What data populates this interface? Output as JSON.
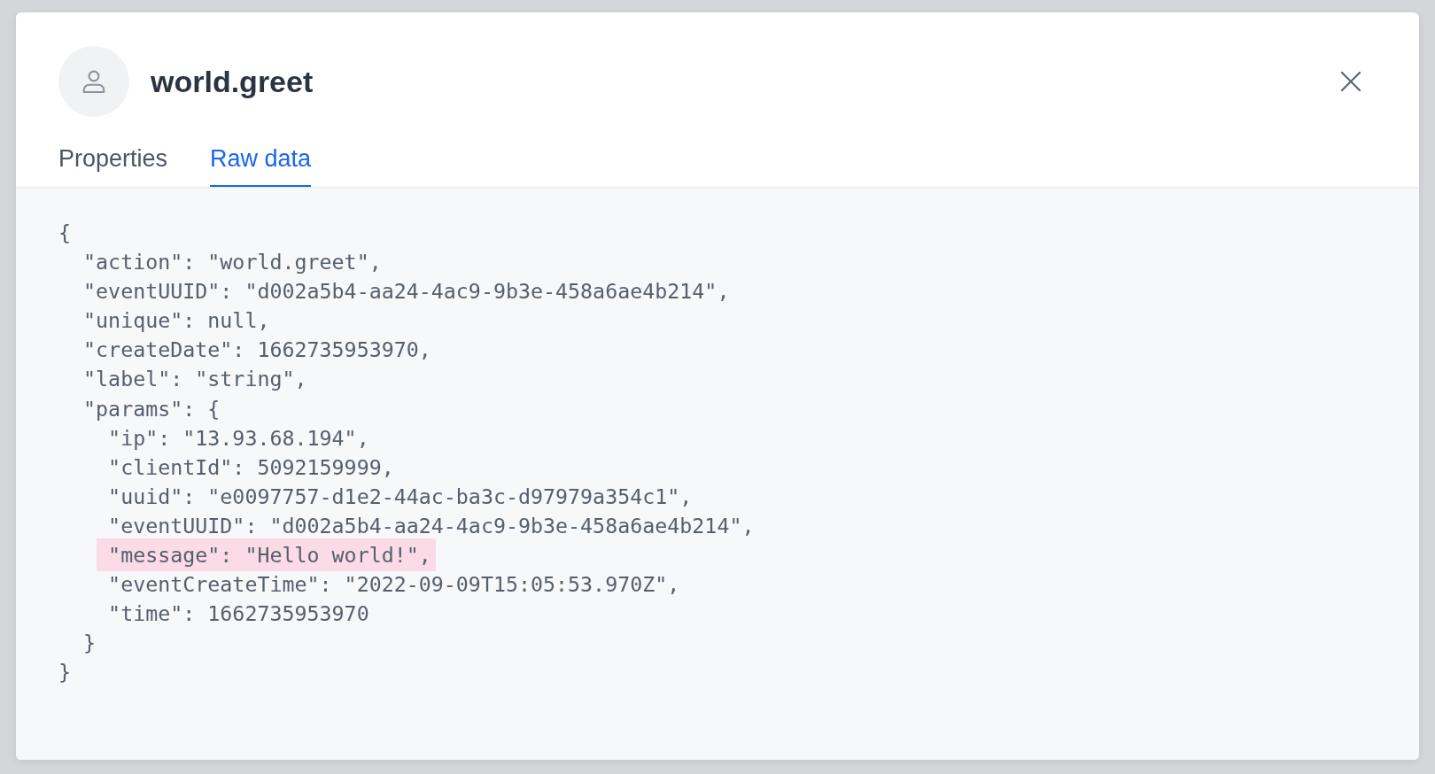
{
  "dialog": {
    "title": "world.greet",
    "tabs": [
      {
        "label": "Properties",
        "selected": false
      },
      {
        "label": "Raw data",
        "selected": true
      }
    ],
    "raw_data": {
      "lines": [
        {
          "text": "{",
          "highlighted": false
        },
        {
          "text": "  \"action\": \"world.greet\",",
          "highlighted": false
        },
        {
          "text": "  \"eventUUID\": \"d002a5b4-aa24-4ac9-9b3e-458a6ae4b214\",",
          "highlighted": false
        },
        {
          "text": "  \"unique\": null,",
          "highlighted": false
        },
        {
          "text": "  \"createDate\": 1662735953970,",
          "highlighted": false
        },
        {
          "text": "  \"label\": \"string\",",
          "highlighted": false
        },
        {
          "text": "  \"params\": {",
          "highlighted": false
        },
        {
          "text": "    \"ip\": \"13.93.68.194\",",
          "highlighted": false
        },
        {
          "text": "    \"clientId\": 5092159999,",
          "highlighted": false
        },
        {
          "text": "    \"uuid\": \"e0097757-d1e2-44ac-ba3c-d97979a354c1\",",
          "highlighted": false
        },
        {
          "text": "    \"eventUUID\": \"d002a5b4-aa24-4ac9-9b3e-458a6ae4b214\",",
          "highlighted": false
        },
        {
          "text": "    \"message\": \"Hello world!\",",
          "highlighted": true
        },
        {
          "text": "    \"eventCreateTime\": \"2022-09-09T15:05:53.970Z\",",
          "highlighted": false
        },
        {
          "text": "    \"time\": 1662735953970",
          "highlighted": false
        },
        {
          "text": "  }",
          "highlighted": false
        },
        {
          "text": "}",
          "highlighted": false
        }
      ]
    }
  }
}
